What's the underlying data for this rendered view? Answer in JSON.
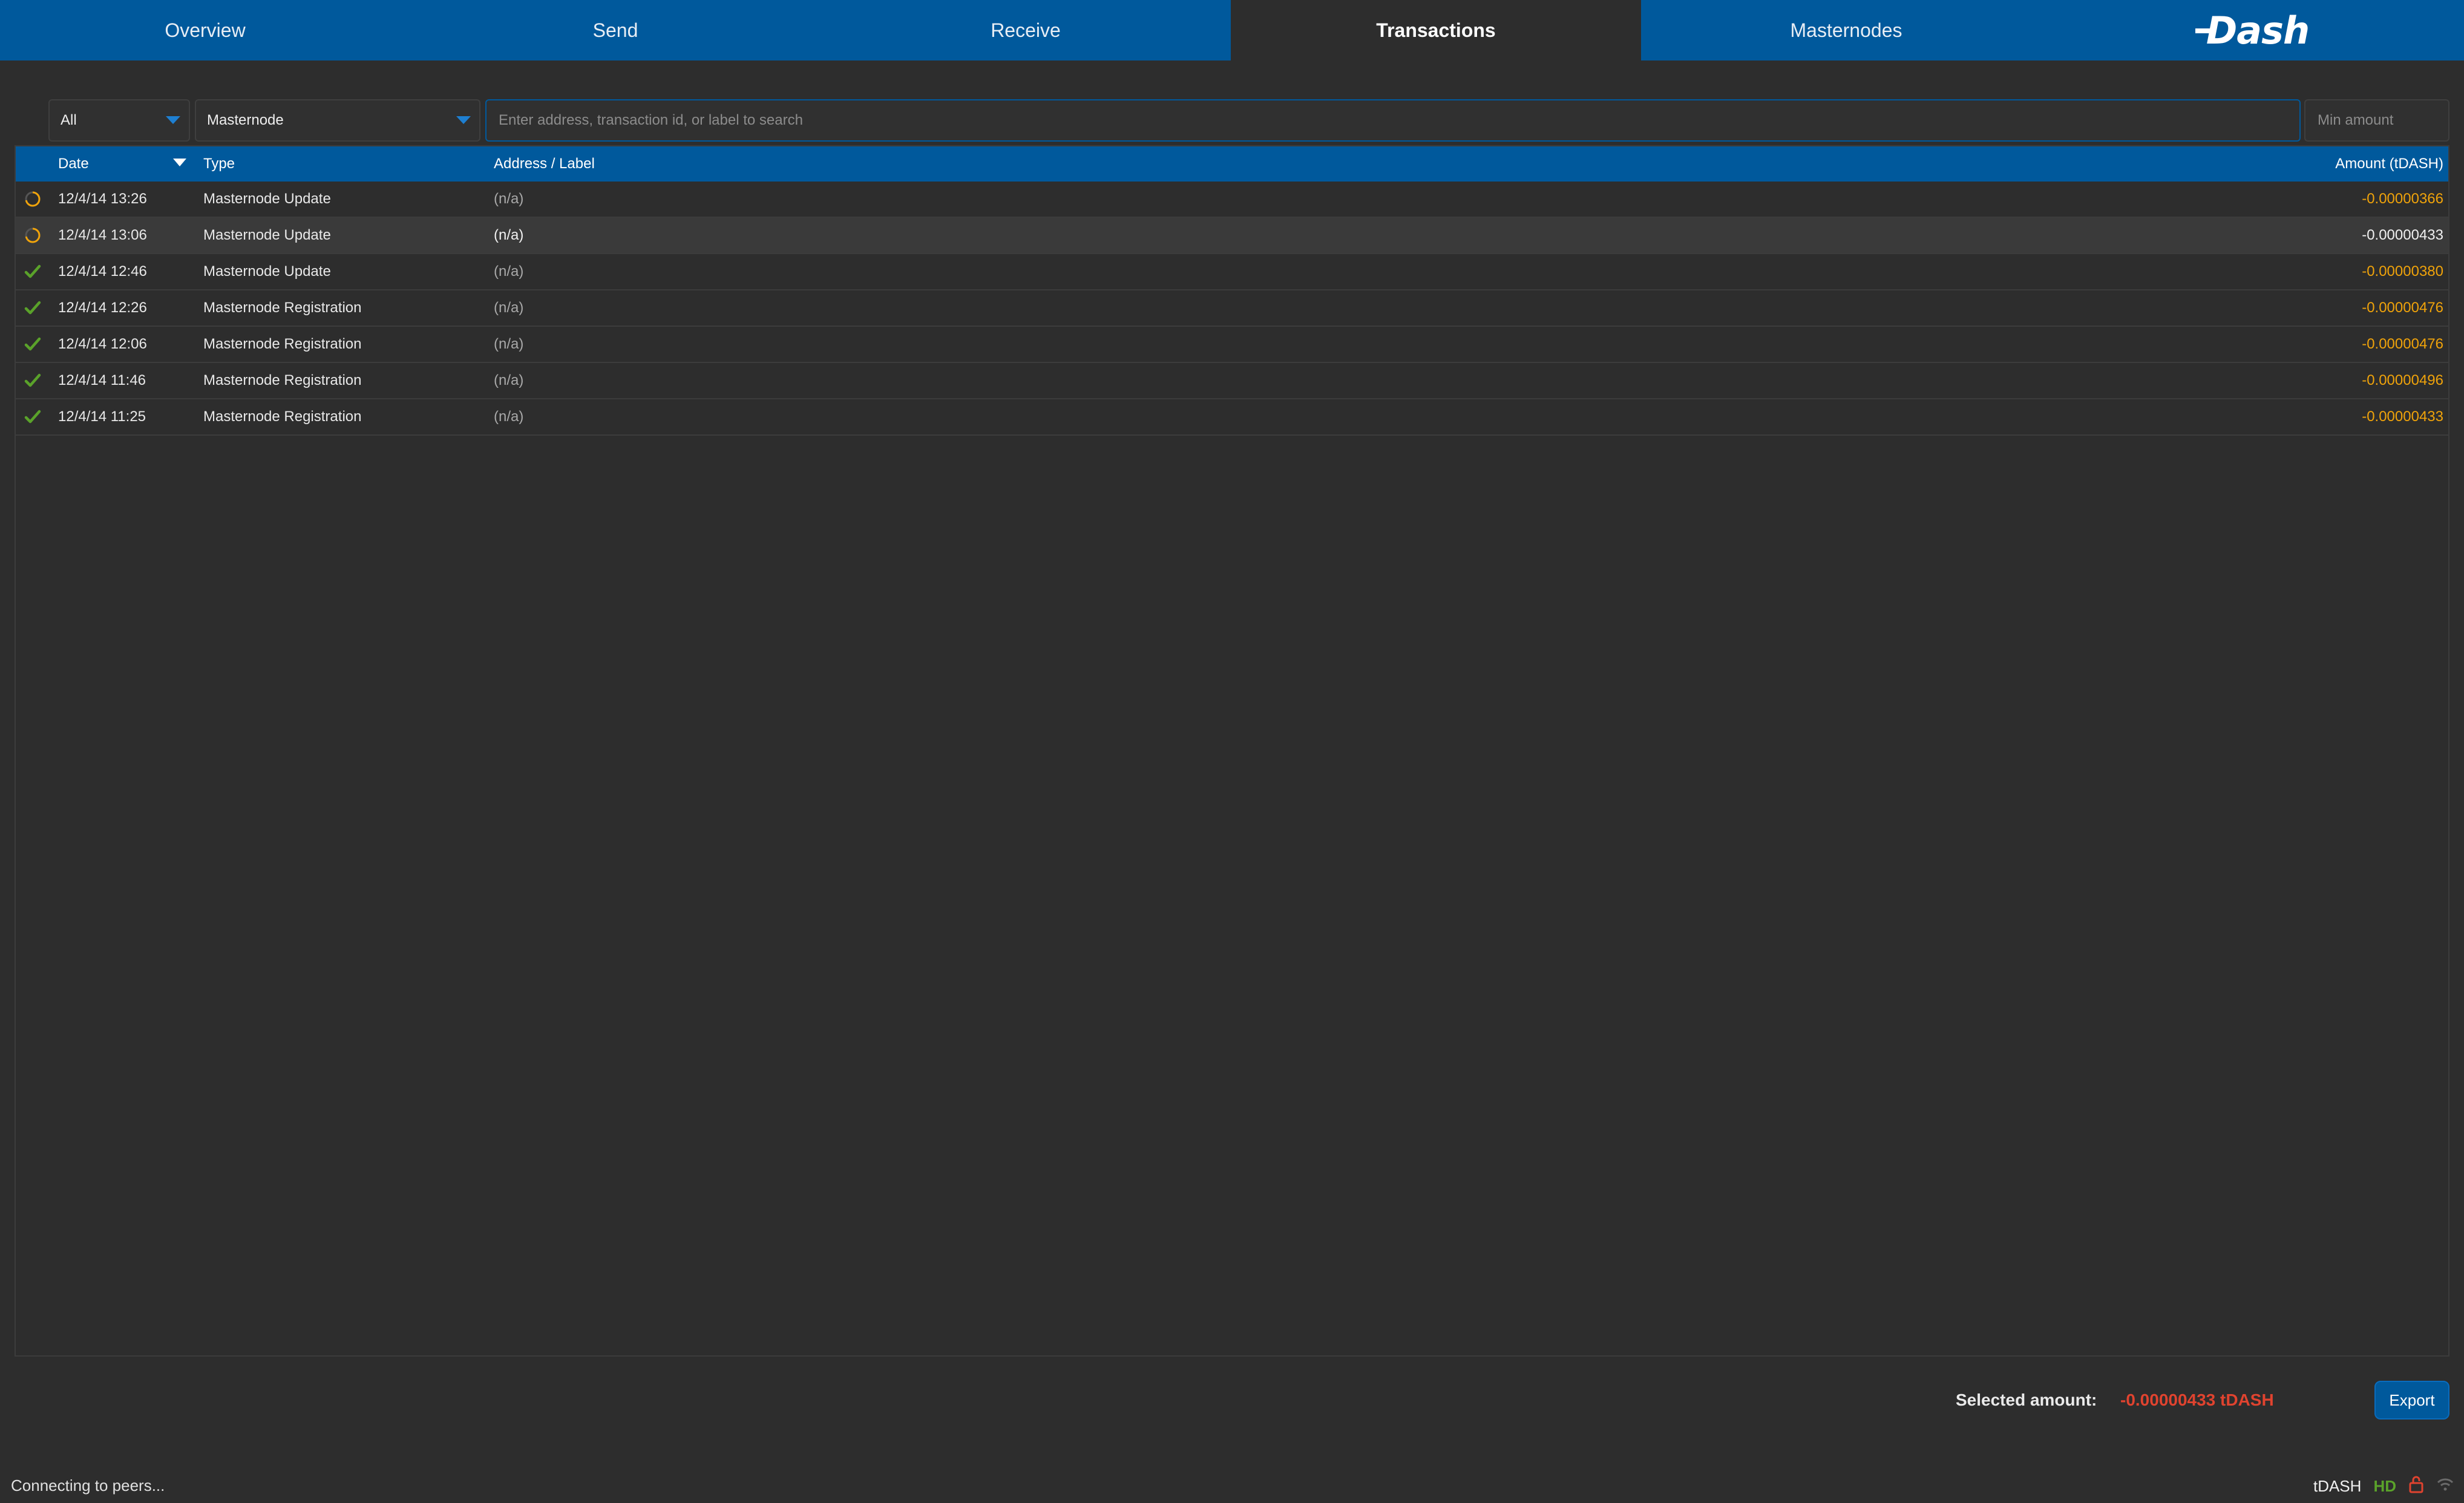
{
  "nav": {
    "tabs": [
      {
        "label": "Overview"
      },
      {
        "label": "Send"
      },
      {
        "label": "Receive"
      },
      {
        "label": "Transactions"
      },
      {
        "label": "Masternodes"
      }
    ],
    "active_tab": "Transactions",
    "logo_text": "Dash"
  },
  "filters": {
    "date_filter": "All",
    "type_filter": "Masternode",
    "search_placeholder": "Enter address, transaction id, or label to search",
    "amount_placeholder": "Min amount"
  },
  "table": {
    "columns": {
      "date": "Date",
      "type": "Type",
      "address": "Address / Label",
      "amount": "Amount (tDASH)"
    },
    "rows": [
      {
        "status": "pending",
        "date": "12/4/14 13:26",
        "type": "Masternode Update",
        "address": "(n/a)",
        "amount": "-0.00000366"
      },
      {
        "status": "pending",
        "date": "12/4/14 13:06",
        "type": "Masternode Update",
        "address": "(n/a)",
        "amount": "-0.00000433",
        "selected": true
      },
      {
        "status": "confirmed",
        "date": "12/4/14 12:46",
        "type": "Masternode Update",
        "address": "(n/a)",
        "amount": "-0.00000380"
      },
      {
        "status": "confirmed",
        "date": "12/4/14 12:26",
        "type": "Masternode Registration",
        "address": "(n/a)",
        "amount": "-0.00000476"
      },
      {
        "status": "confirmed",
        "date": "12/4/14 12:06",
        "type": "Masternode Registration",
        "address": "(n/a)",
        "amount": "-0.00000476"
      },
      {
        "status": "confirmed",
        "date": "12/4/14 11:46",
        "type": "Masternode Registration",
        "address": "(n/a)",
        "amount": "-0.00000496"
      },
      {
        "status": "confirmed",
        "date": "12/4/14 11:25",
        "type": "Masternode Registration",
        "address": "(n/a)",
        "amount": "-0.00000433"
      }
    ]
  },
  "footer": {
    "selected_label": "Selected amount:",
    "selected_value": "-0.00000433 tDASH",
    "export_label": "Export"
  },
  "statusbar": {
    "message": "Connecting to peers...",
    "unit": "tDASH",
    "hd": "HD"
  },
  "colors": {
    "accent": "#00599c",
    "amount_negative": "#f0a30a",
    "selected_amount": "#e0432f",
    "confirmed_check": "#5aa22a",
    "pending": "#f0a30a",
    "lock": "#e0432f"
  }
}
